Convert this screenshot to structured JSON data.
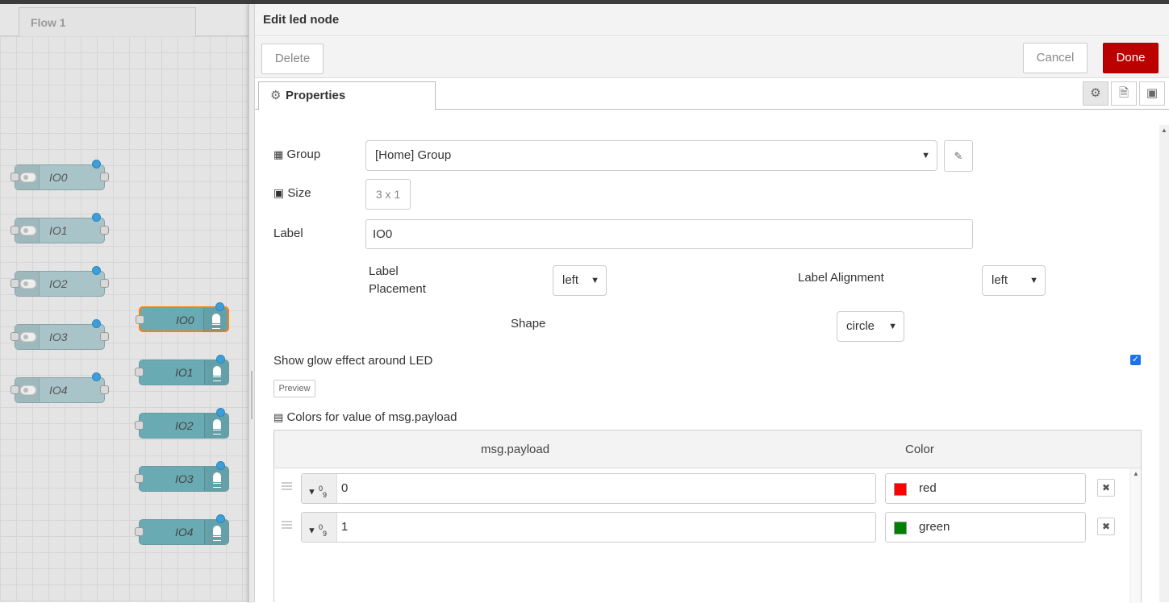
{
  "workspace": {
    "flow_tab": "Flow 1",
    "switch_nodes": [
      "IO0",
      "IO1",
      "IO2",
      "IO3",
      "IO4"
    ],
    "led_nodes": [
      "IO0",
      "IO1",
      "IO2",
      "IO3",
      "IO4"
    ],
    "selected_led": "IO0"
  },
  "tray": {
    "title": "Edit led node",
    "delete_label": "Delete",
    "cancel_label": "Cancel",
    "done_label": "Done",
    "properties_tab": "Properties",
    "side_tabs": [
      "gear-icon",
      "description-icon",
      "appearance-icon"
    ]
  },
  "form": {
    "group_label": "Group",
    "group_value": "[Home] Group",
    "size_label": "Size",
    "size_value": "3 x 1",
    "label_label": "Label",
    "label_value": "IO0",
    "label_placement_label": "Label\nPlacement",
    "label_placement_value": "left",
    "label_alignment_label": "Label Alignment",
    "label_alignment_value": "left",
    "shape_label": "Shape",
    "shape_value": "circle",
    "glow_label": "Show glow effect around LED",
    "glow_checked": true,
    "preview_label": "Preview",
    "colors_label": "Colors for value of msg.payload",
    "colors_table": {
      "col_payload": "msg.payload",
      "col_color": "Color",
      "rows": [
        {
          "value": "0",
          "color_name": "red",
          "color_hex": "#ff0000"
        },
        {
          "value": "1",
          "color_name": "green",
          "color_hex": "#008000"
        }
      ]
    }
  },
  "colors": {
    "done_button": "#bb0000",
    "node_switch": "#a9c4c8",
    "node_led": "#6aaab3",
    "selected_outline": "#ff7f0e",
    "status_dot": "#3e9fd8"
  }
}
